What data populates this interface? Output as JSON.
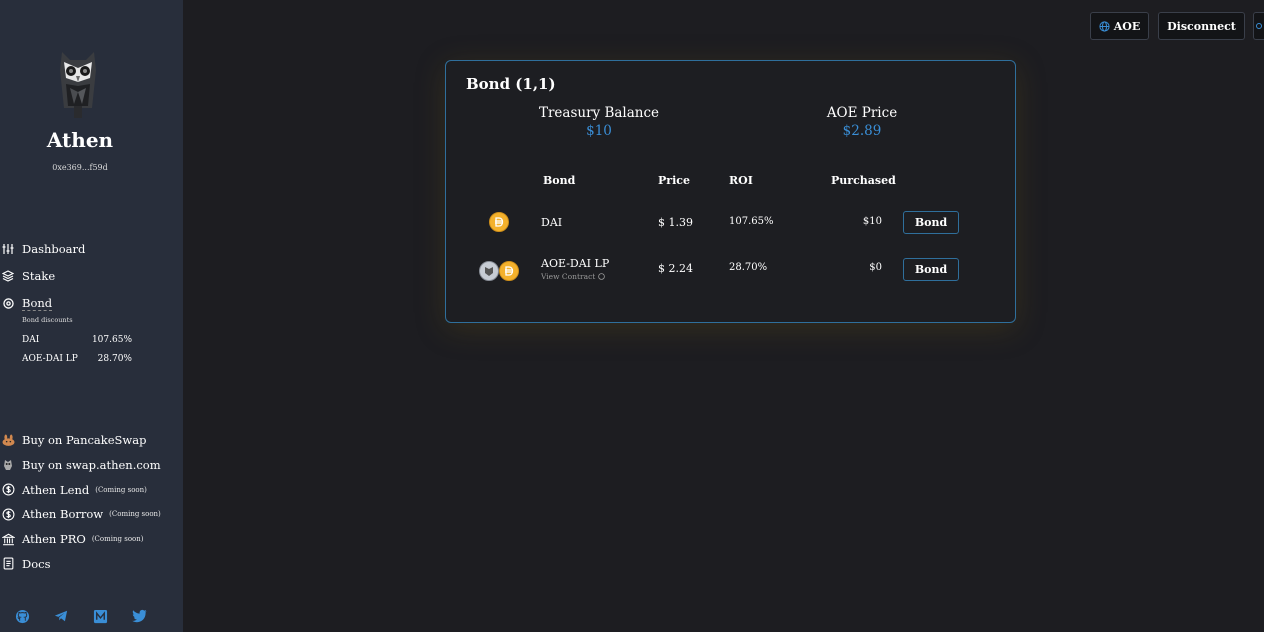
{
  "sidebar": {
    "brand": "Athen",
    "address": "0xe369...f59d",
    "nav": [
      {
        "label": "Dashboard",
        "icon": "sliders-icon"
      },
      {
        "label": "Stake",
        "icon": "layers-icon"
      },
      {
        "label": "Bond",
        "icon": "gear-icon"
      }
    ],
    "bond_discounts": {
      "title": "Bond discounts",
      "items": [
        {
          "name": "DAI",
          "value": "107.65%"
        },
        {
          "name": "AOE-DAI LP",
          "value": "28.70%"
        }
      ]
    },
    "external": [
      {
        "label": "Buy on PancakeSwap",
        "soon": "",
        "icon": "pancake-icon"
      },
      {
        "label": "Buy on swap.athen.com",
        "soon": "",
        "icon": "owl-icon"
      },
      {
        "label": "Athen Lend",
        "soon": "(Coming soon)",
        "icon": "dollar-circle-icon"
      },
      {
        "label": "Athen Borrow",
        "soon": "(Coming soon)",
        "icon": "dollar-circle-icon"
      },
      {
        "label": "Athen PRO",
        "soon": "(Coming soon)",
        "icon": "bank-icon"
      },
      {
        "label": "Docs",
        "soon": "",
        "icon": "docs-icon"
      }
    ],
    "social": [
      "github-icon",
      "telegram-icon",
      "medium-icon",
      "twitter-icon"
    ]
  },
  "topbar": {
    "token_label": "AOE",
    "disconnect_label": "Disconnect"
  },
  "card": {
    "title": "Bond (1,1)",
    "treasury": {
      "label": "Treasury Balance",
      "value": "$10"
    },
    "price": {
      "label": "AOE Price",
      "value": "$2.89"
    },
    "columns": [
      "Bond",
      "Price",
      "ROI",
      "Purchased"
    ],
    "rows": [
      {
        "name": "DAI",
        "sub": "",
        "price": "$ 1.39",
        "roi": "107.65%",
        "purchased": "$10",
        "action": "Bond"
      },
      {
        "name": "AOE-DAI LP",
        "sub": "View Contract",
        "price": "$ 2.24",
        "roi": "28.70%",
        "purchased": "$0",
        "action": "Bond"
      }
    ]
  },
  "colors": {
    "accent": "#3a8ed6",
    "border": "#2f6f9c",
    "sidebar": "#282e3b",
    "background": "#1d1d21",
    "dai": "#f4b12c"
  }
}
